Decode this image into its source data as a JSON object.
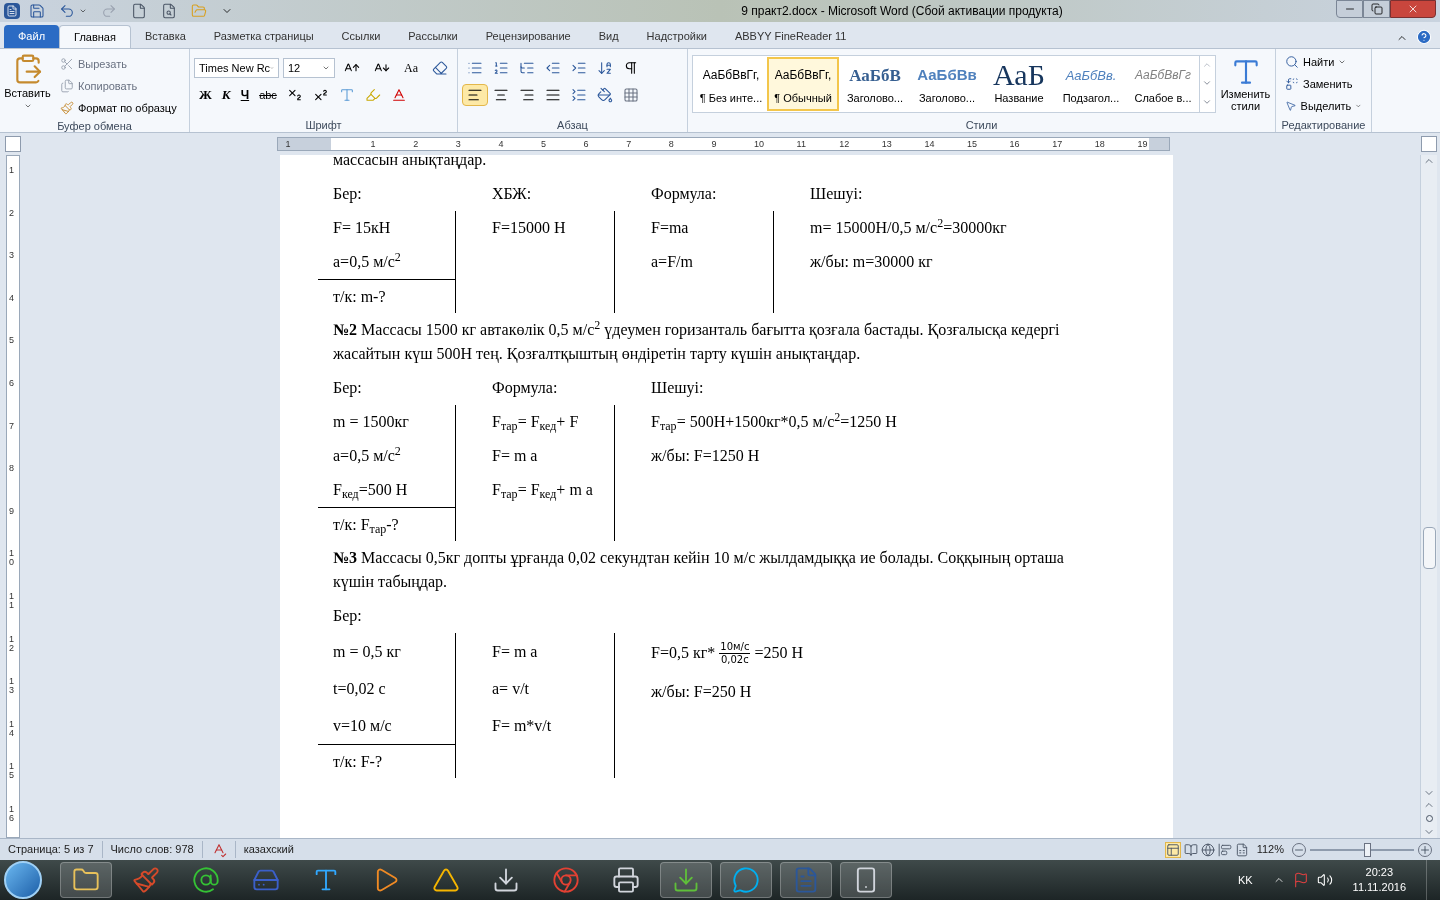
{
  "window": {
    "title": "9 практ2.docx  -  Microsoft Word (Сбой активации продукта)"
  },
  "tabs": [
    {
      "label": "Файл",
      "kind": "file",
      "selected": false
    },
    {
      "label": "Главная",
      "kind": "tab",
      "selected": true
    },
    {
      "label": "Вставка",
      "kind": "tab",
      "selected": false
    },
    {
      "label": "Разметка страницы",
      "kind": "tab",
      "selected": false
    },
    {
      "label": "Ссылки",
      "kind": "tab",
      "selected": false
    },
    {
      "label": "Рассылки",
      "kind": "tab",
      "selected": false
    },
    {
      "label": "Рецензирование",
      "kind": "tab",
      "selected": false
    },
    {
      "label": "Вид",
      "kind": "tab",
      "selected": false
    },
    {
      "label": "Надстройки",
      "kind": "tab",
      "selected": false
    },
    {
      "label": "ABBYY FineReader 11",
      "kind": "tab",
      "selected": false
    }
  ],
  "clipboard": {
    "paste": "Вставить",
    "cut": "Вырезать",
    "copy": "Копировать",
    "format_painter": "Формат по образцу",
    "title": "Буфер обмена"
  },
  "font": {
    "name": "Times New Rc",
    "size": "12",
    "change_case": "Aa",
    "bold": "Ж",
    "italic": "К",
    "underline": "Ч",
    "strike": "abc",
    "title": "Шрифт"
  },
  "paragraph": {
    "title": "Абзац",
    "alignment": [
      {
        "kind": "left",
        "selected": true
      },
      {
        "kind": "center",
        "selected": false
      },
      {
        "kind": "right",
        "selected": false
      },
      {
        "kind": "justify",
        "selected": false
      }
    ]
  },
  "styles": {
    "title": "Стили",
    "change": "Изменить стили",
    "items": [
      {
        "preview": "АаБбВвГг,",
        "label": "¶ Без инте...",
        "kind": "normal",
        "selected": false
      },
      {
        "preview": "АаБбВвГг,",
        "label": "¶ Обычный",
        "kind": "normal",
        "selected": true
      },
      {
        "preview": "АаБбВ",
        "label": "Заголово...",
        "kind": "heading1",
        "selected": false
      },
      {
        "preview": "АаБбВв",
        "label": "Заголово...",
        "kind": "heading2",
        "selected": false
      },
      {
        "preview": "АаБ",
        "label": "Название",
        "kind": "title",
        "selected": false
      },
      {
        "preview": "АаБбВв.",
        "label": "Подзагол...",
        "kind": "subtitle",
        "selected": false
      },
      {
        "preview": "АаБбВвГг",
        "label": "Слабое в...",
        "kind": "subtle",
        "selected": false
      }
    ]
  },
  "editing": {
    "title": "Редактирование",
    "find": "Найти",
    "replace": "Заменить",
    "select": "Выделить"
  },
  "ruler": {
    "horizontal": [
      "1",
      "1",
      "2",
      "3",
      "4",
      "5",
      "6",
      "7",
      "8",
      "9",
      "10",
      "11",
      "12",
      "13",
      "14",
      "15",
      "16",
      "17",
      "18",
      "19"
    ],
    "vertical": [
      "1",
      "2",
      "3",
      "4",
      "5",
      "6",
      "7",
      "8",
      "9",
      "10",
      "11",
      "12",
      "13",
      "14",
      "15",
      "16"
    ]
  },
  "document": [
    {
      "kind": "para",
      "text": "массасын анықтаңдар."
    },
    {
      "kind": "table",
      "columns": [
        {
          "heading": "Бер:",
          "lines": [
            "F= 15кН",
            "a=0,5 м/с$^{2}$"
          ],
          "find": "т/к: m-?",
          "divider": true
        },
        {
          "heading": "ХБЖ:",
          "lines": [
            "F=15000 Н"
          ],
          "divider": true
        },
        {
          "heading": "Формула:",
          "lines": [
            "F=ma",
            "a=F/m"
          ],
          "divider": true
        },
        {
          "heading": "Шешуі:",
          "lines": [
            "m= 15000Н/0,5 м/с$^{2}$=30000кг",
            "ж/бы: m=30000 кг"
          ],
          "divider": false
        }
      ]
    },
    {
      "kind": "para",
      "text": "**№2** Массасы 1500 кг автакөлік 0,5 м/с$^{2}$  үдеумен горизанталь бағытта қозғала бастады. Қозғалысқа кедергі жасайтын күш 500Н тең. Қозғалтқыштың өндіретін тарту күшін анықтаңдар."
    },
    {
      "kind": "table",
      "columns": [
        {
          "heading": "Бер:",
          "lines": [
            "m = 1500кг",
            "a=0,5 м/с$^{2}$",
            "F$_{кед}$=500 Н"
          ],
          "find": "т/к: F$_{тар}$-?",
          "divider": true
        },
        {
          "heading": "Формула:",
          "lines": [
            "F$_{тар}$= F$_{кед}$+ F",
            "F= m a",
            "F$_{тар}$= F$_{кед}$+ m a"
          ],
          "divider": true
        },
        {
          "heading": "Шешуі:",
          "lines": [
            "F$_{тар}$= 500Н+1500кг*0,5 м/с$^{2}$=1250 Н",
            "ж/бы: F=1250 Н"
          ],
          "divider": false
        }
      ]
    },
    {
      "kind": "para",
      "text": "**№3**  Массасы 0,5кг допты ұрғанда 0,02 секундтан кейін 10 м/с жылдамдыққа ие болады. Соққының орташа күшін табыңдар."
    },
    {
      "kind": "para",
      "text": "Бер:"
    },
    {
      "kind": "table",
      "columns": [
        {
          "lines": [
            "m = 0,5 кг",
            "t=0,02 с",
            "v=10 м/с"
          ],
          "find": "т/к: F-?",
          "divider": true
        },
        {
          "lines": [
            "F= m a",
            "a= v/t",
            "F= m*v/t"
          ],
          "divider": true
        },
        {
          "fraction": {
            "before": "F=0,5 кг*",
            "numerator": "10м/с",
            "denominator": "0,02с",
            "after": "=250 Н"
          },
          "lines": [
            "ж/бы: F=250 Н"
          ],
          "divider": false
        }
      ]
    }
  ],
  "status_bar": {
    "page": "Страница: 5 из 7",
    "words": "Число слов: 978",
    "language": "казахский",
    "zoom": "112%",
    "level": 0.56
  },
  "taskbar": {
    "language": "KK",
    "time": "20:23",
    "date": "11.11.2016"
  }
}
